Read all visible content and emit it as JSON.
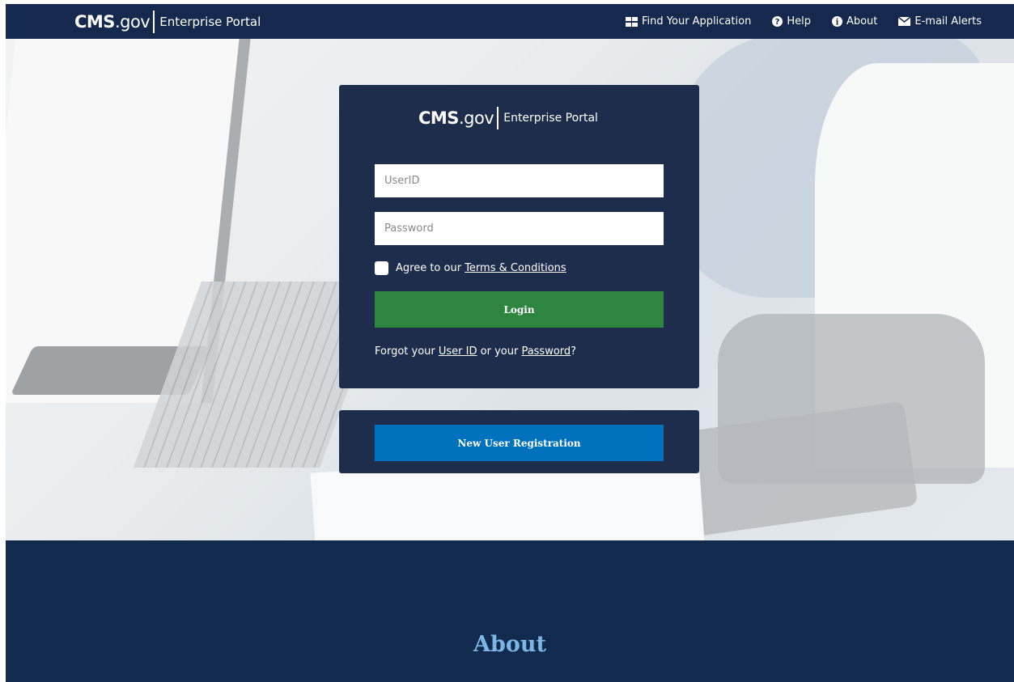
{
  "header": {
    "brand": {
      "cms": "CMS",
      "gov": ".gov",
      "portal": "Enterprise Portal"
    },
    "nav": [
      {
        "label": "Find Your Application",
        "icon": "grid-icon"
      },
      {
        "label": "Help",
        "icon": "question-circle-icon"
      },
      {
        "label": "About",
        "icon": "info-circle-icon"
      },
      {
        "label": "E-mail Alerts",
        "icon": "envelope-icon"
      }
    ]
  },
  "login": {
    "brand": {
      "cms": "CMS",
      "gov": ".gov",
      "portal": "Enterprise Portal"
    },
    "userid_placeholder": "UserID",
    "password_placeholder": "Password",
    "agree_prefix": "Agree to our ",
    "terms_link": "Terms & Conditions",
    "login_button": "Login",
    "forgot": {
      "prefix": "Forgot your ",
      "userid_link": "User ID",
      "middle": " or your ",
      "password_link": "Password",
      "suffix": "?"
    }
  },
  "registration": {
    "button": "New User Registration"
  },
  "footer": {
    "heading": "About"
  },
  "colors": {
    "header_bg": "#14294d",
    "card_bg": "#1d2d4b",
    "login_green": "#2e8540",
    "register_blue": "#0071bc",
    "footer_bg": "#132a4f",
    "about_heading": "#7ab6e6"
  }
}
